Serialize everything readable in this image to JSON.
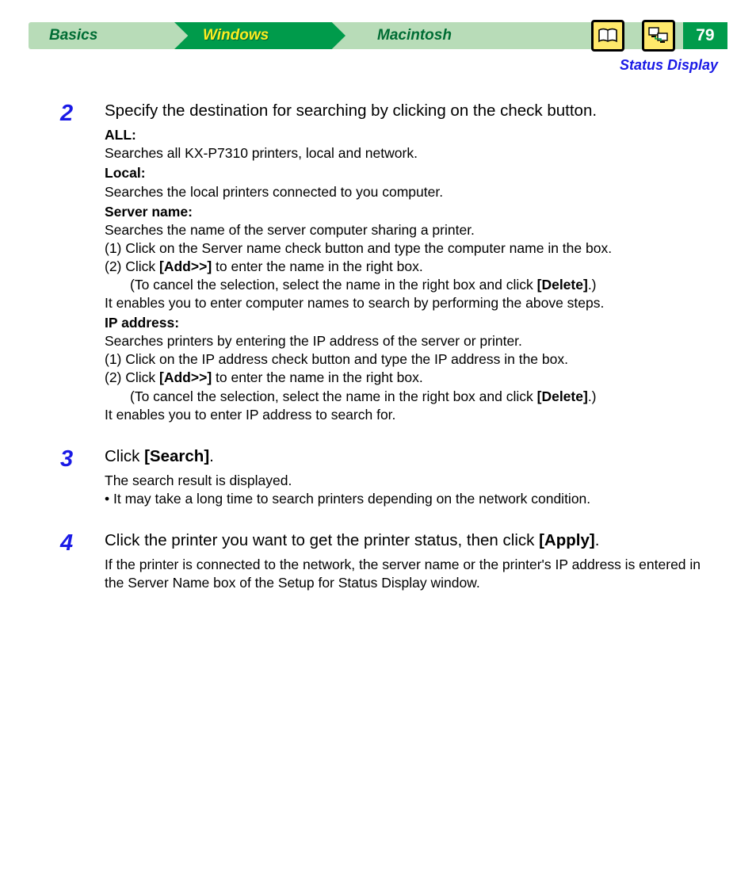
{
  "nav": {
    "tabs": {
      "basics": "Basics",
      "windows": "Windows",
      "macintosh": "Macintosh"
    },
    "page_number": "79",
    "breadcrumb": "Status Display"
  },
  "step2": {
    "num": "2",
    "lead": "Specify the destination for searching by clicking on the check button.",
    "all_head": "ALL:",
    "all_body": "Searches all KX-P7310 printers, local and network.",
    "local_head": "Local:",
    "local_body": "Searches the local printers connected to you computer.",
    "server_head": "Server name:",
    "server_body": "Searches the name of the server computer sharing a printer.",
    "server_1": "(1) Click on the Server name check button and type the computer name in the box.",
    "server_2a": "(2) Click ",
    "add_bold": "[Add>>]",
    "server_2b": " to enter the name in the right box.",
    "server_cancel_a": "(To cancel the selection, select the name in the right box and click ",
    "del_bold": "[Delete]",
    "server_cancel_b": ".)",
    "server_tail": "It enables you to enter computer names to search by performing the above steps.",
    "ip_head": "IP address:",
    "ip_body": "Searches printers by entering the IP address of the server or printer.",
    "ip_1": "(1) Click on the IP address check button and type the IP address in the box.",
    "ip_2a": "(2) Click ",
    "ip_2b": " to enter the name in the right box.",
    "ip_cancel_a": "(To cancel the selection, select the name in the right box and click ",
    "ip_cancel_b": ".)",
    "ip_tail": "It enables you to enter IP address to search for."
  },
  "step3": {
    "num": "3",
    "lead_a": "Click ",
    "search_bold": "[Search]",
    "lead_b": ".",
    "body1": "The search result is displayed.",
    "body2": "It may take a long time to search printers depending on the network condition."
  },
  "step4": {
    "num": "4",
    "lead_a": "Click the printer you want to get the printer status, then click ",
    "apply_bold": "[Apply]",
    "lead_b": ".",
    "body": "If the printer is connected to the network, the server name or the printer's IP address is entered in the Server Name box of the Setup for Status Display window."
  }
}
